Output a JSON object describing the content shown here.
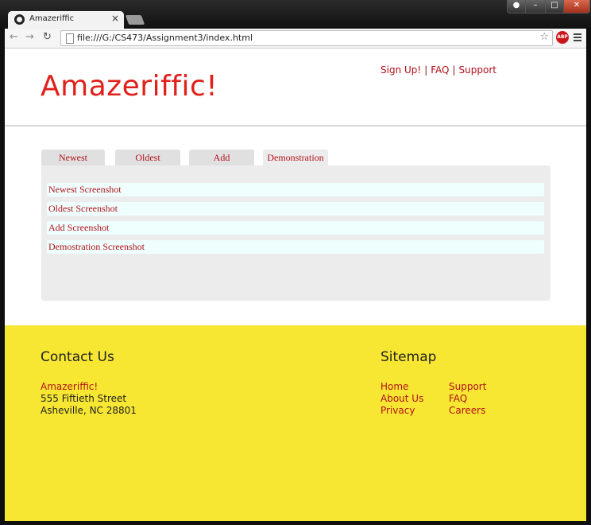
{
  "browser": {
    "tab_title": "Amazeriffic",
    "tab_close": "×",
    "url": "file:///G:/CS473/Assignment3/index.html",
    "abp_label": "ABP",
    "nav_back": "←",
    "nav_forward": "→",
    "nav_reload": "↻",
    "star": "☆"
  },
  "header": {
    "logo": "Amazeriffic!",
    "links": [
      "Sign Up!",
      "FAQ",
      "Support"
    ],
    "separator": "|"
  },
  "tabs": [
    "Newest",
    "Oldest",
    "Add",
    "Demonstration"
  ],
  "active_tab": "Demonstration",
  "content": {
    "items": [
      "Newest Screenshot",
      "Oldest Screenshot",
      "Add Screenshot",
      "Demostration Screenshot"
    ]
  },
  "footer": {
    "contact_title": "Contact Us",
    "address": [
      "Amazeriffic!",
      "555 Fiftieth Street",
      "Asheville, NC 28801"
    ],
    "sitemap_title": "Sitemap",
    "sitemap_col1": [
      "Home",
      "About Us",
      "Privacy"
    ],
    "sitemap_col2": [
      "Support",
      "FAQ",
      "Careers"
    ]
  },
  "colors": {
    "logo": "#e0201b",
    "link": "#b2111b",
    "footer_bg": "#f7e733",
    "panel_bg": "#ececec",
    "item_bg": "#eefffd"
  }
}
